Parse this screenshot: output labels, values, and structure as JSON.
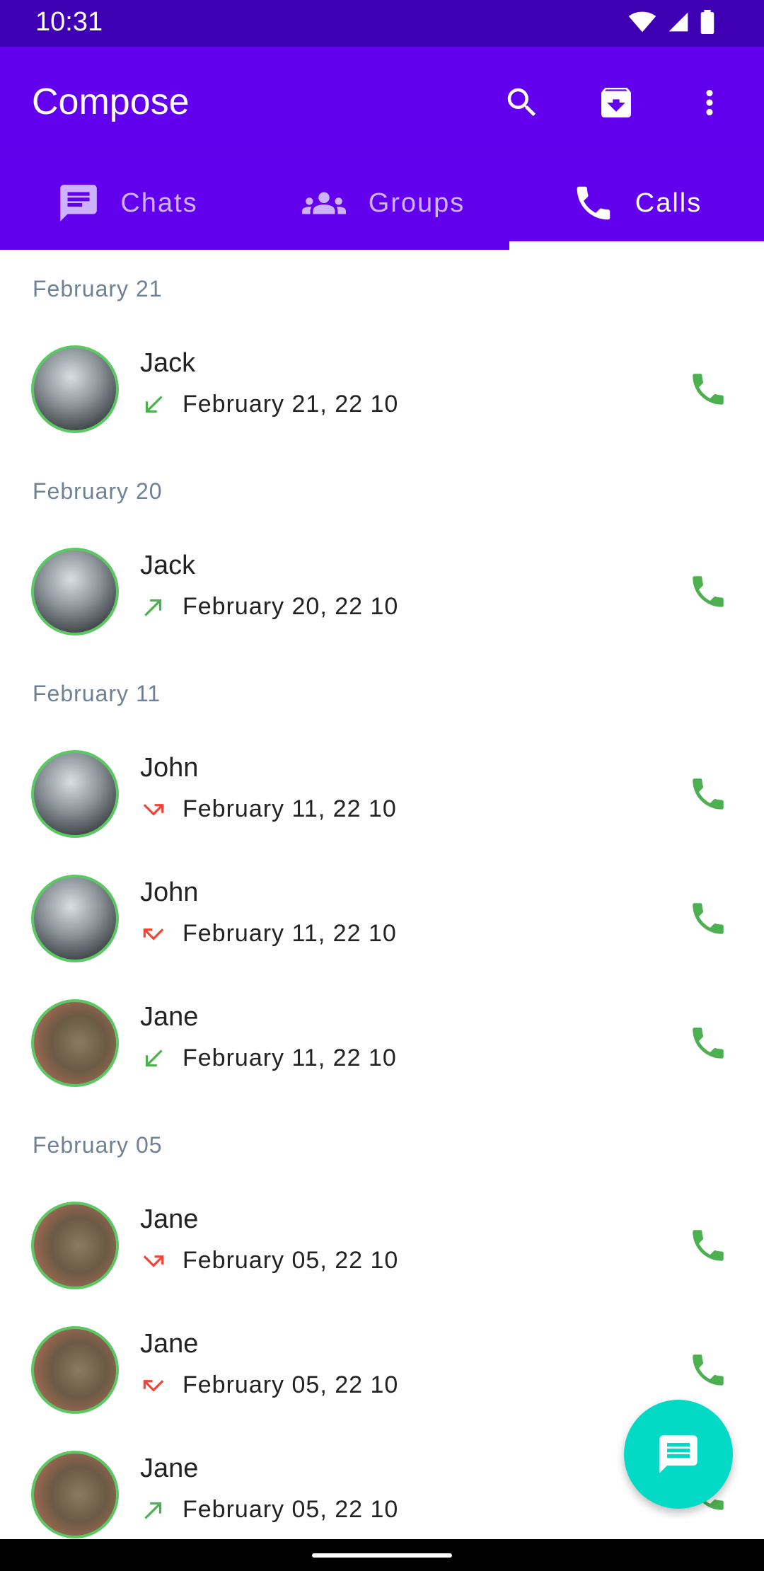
{
  "status_bar": {
    "time": "10:31"
  },
  "app_bar": {
    "title": "Compose",
    "actions": [
      "search-icon",
      "archive-icon",
      "more-vert-icon"
    ]
  },
  "tabs": [
    {
      "label": "Chats",
      "icon": "chat-icon",
      "selected": false
    },
    {
      "label": "Groups",
      "icon": "groups-icon",
      "selected": false
    },
    {
      "label": "Calls",
      "icon": "phone-icon",
      "selected": true
    }
  ],
  "calls": {
    "groups": [
      {
        "date": "February 21",
        "items": [
          {
            "name": "Jack",
            "time": "February 21, 22 10",
            "type": "incoming"
          }
        ]
      },
      {
        "date": "February 20",
        "items": [
          {
            "name": "Jack",
            "time": "February 20, 22 10",
            "type": "outgoing"
          }
        ]
      },
      {
        "date": "February 11",
        "items": [
          {
            "name": "John",
            "time": "February 11, 22 10",
            "type": "missed-outgoing"
          },
          {
            "name": "John",
            "time": "February 11, 22 10",
            "type": "missed"
          },
          {
            "name": "Jane",
            "time": "February 11, 22 10",
            "type": "incoming"
          }
        ]
      },
      {
        "date": "February 05",
        "items": [
          {
            "name": "Jane",
            "time": "February 05, 22 10",
            "type": "missed-outgoing"
          },
          {
            "name": "Jane",
            "time": "February 05, 22 10",
            "type": "missed"
          },
          {
            "name": "Jane",
            "time": "February 05, 22 10",
            "type": "outgoing"
          }
        ]
      }
    ]
  },
  "fab": {
    "icon": "message-icon"
  },
  "colors": {
    "primary": "#6200ee",
    "primary_dark": "#3f00b3",
    "accent": "#03dac5",
    "call_green": "#4caf50",
    "missed_red": "#f44336"
  }
}
